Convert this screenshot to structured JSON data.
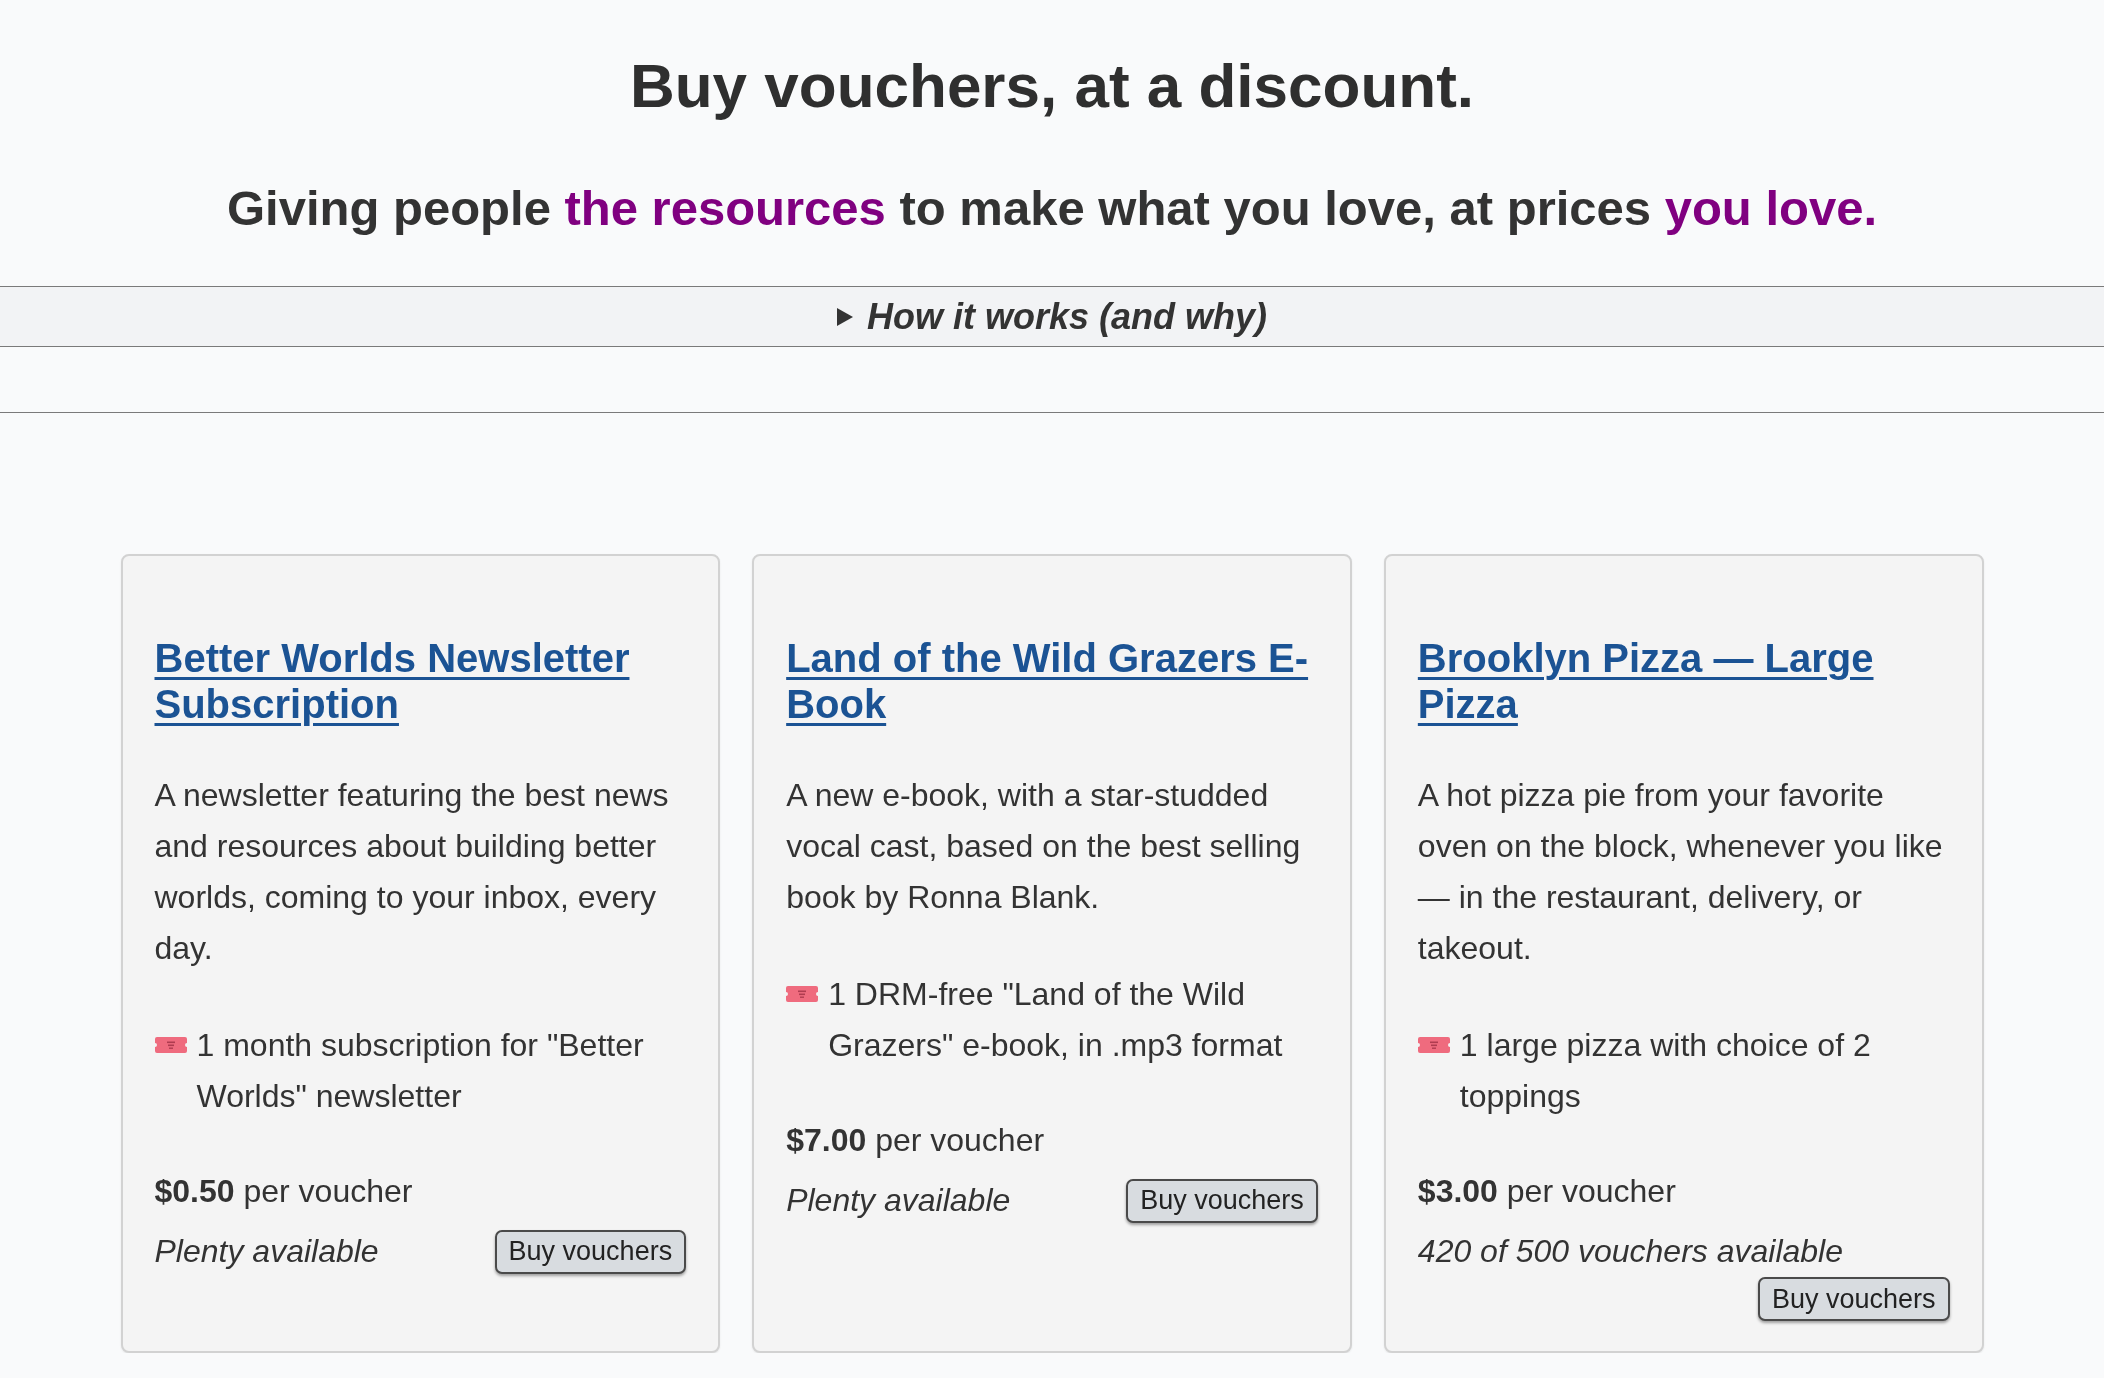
{
  "header": {
    "title": "Buy vouchers, at a discount.",
    "tagline": [
      {
        "text": "Giving people ",
        "highlight": false
      },
      {
        "text": "the resources",
        "highlight": true
      },
      {
        "text": " to make what you love, at prices ",
        "highlight": false
      },
      {
        "text": "you love.",
        "highlight": true
      }
    ]
  },
  "how_it_works": {
    "label": "How it works (and why)",
    "expanded": false
  },
  "products": [
    {
      "title": "Better Worlds Newsletter Subscription",
      "description": "A newsletter featuring the best news and resources about building better worlds, coming to your inbox, every day.",
      "voucher": "1 month subscription for \"Better Worlds\" newsletter",
      "price": "**$0.50** per voucher",
      "availability": "Plenty available",
      "button": "Buy vouchers"
    },
    {
      "title": "Land of the Wild Grazers E-Book",
      "description": "A new e-book, with a star-studded vocal cast, based on the best selling book by Ronna Blank.",
      "voucher": "1 DRM-free \"Land of the Wild Grazers\" e-book, in .mp3 format",
      "price": "**$7.00** per voucher",
      "availability": "Plenty available",
      "button": "Buy vouchers"
    },
    {
      "title": "Brooklyn Pizza — Large Pizza",
      "description": "A hot pizza pie from your favorite oven on the block, whenever you like — in the restaurant, delivery, or takeout.",
      "voucher": "1 large pizza with choice of 2 toppings",
      "price": "**$3.00** per voucher",
      "availability": "420 of 500 vouchers available",
      "button": "Buy vouchers"
    }
  ]
}
